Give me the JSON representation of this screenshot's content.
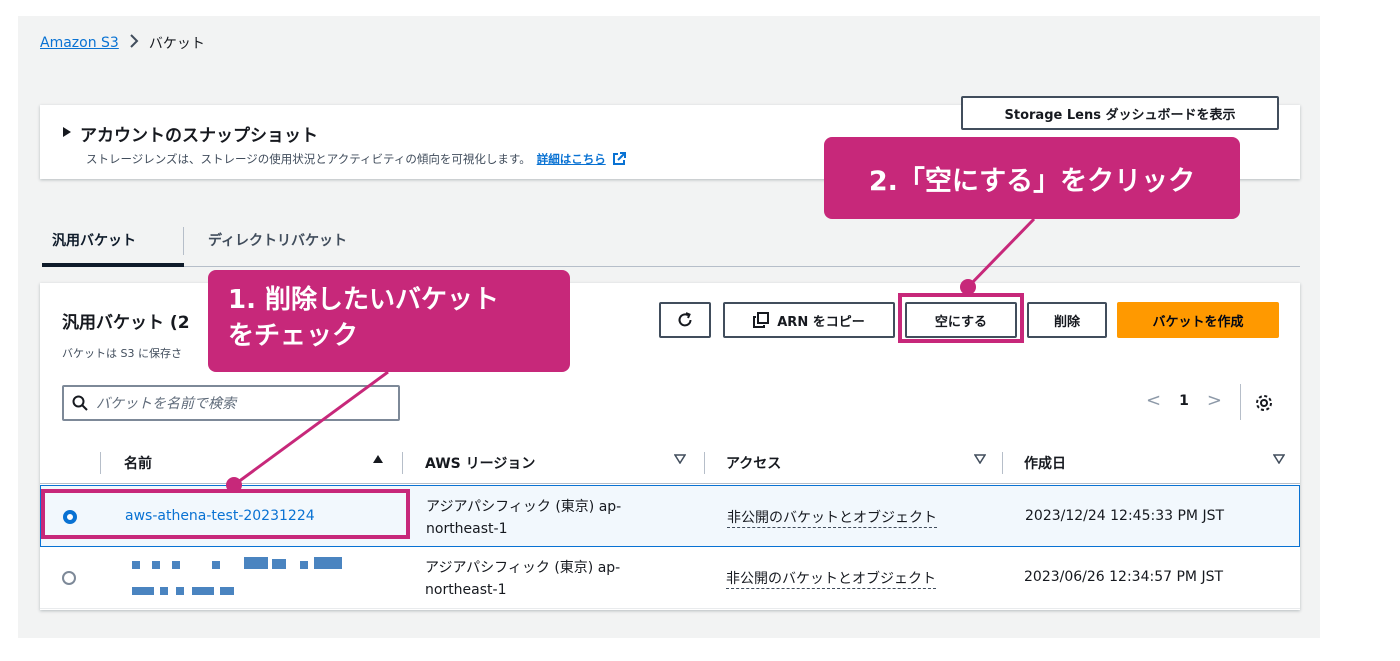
{
  "breadcrumb": {
    "root": "Amazon S3",
    "separator": ">",
    "current": "バケット"
  },
  "snapshot": {
    "title": "アカウントのスナップショット",
    "description": "ストレージレンズは、ストレージの使用状況とアクティビティの傾向を可視化します。",
    "details_link": "詳細はこちら",
    "storage_lens_button": "Storage Lens ダッシュボードを表示"
  },
  "tabs": [
    {
      "label": "汎用バケット",
      "active": true
    },
    {
      "label": "ディレクトリバケット",
      "active": false
    }
  ],
  "buckets": {
    "title": "汎用バケット (2",
    "description": "バケットは S3 に保存さ",
    "actions": {
      "copy_arn": "ARN をコピー",
      "empty": "空にする",
      "delete": "削除",
      "create": "バケットを作成"
    },
    "search_placeholder": "バケットを名前で検索",
    "pagination": {
      "page": "1",
      "prev": "<",
      "next": ">"
    },
    "columns": [
      "名前",
      "AWS リージョン",
      "アクセス",
      "作成日"
    ],
    "rows": [
      {
        "name": "aws-athena-test-20231224",
        "region_line1": "アジアパシフィック (東京) ap-",
        "region_line2": "northeast-1",
        "access": "非公開のバケットとオブジェクト",
        "created": "2023/12/24 12:45:33 PM JST",
        "selected": true
      },
      {
        "name": "",
        "region_line1": "アジアパシフィック (東京) ap-",
        "region_line2": "northeast-1",
        "access": "非公開のバケットとオブジェクト",
        "created": "2023/06/26 12:34:57 PM JST",
        "selected": false
      }
    ]
  },
  "annotations": {
    "callout_1_line1": "1. 削除したいバケット",
    "callout_1_line2": "をチェック",
    "callout_2": "2.「空にする」をクリック",
    "color": "#c7287a"
  },
  "colors": {
    "link": "#0972d3",
    "primary": "#ff9900",
    "annotation": "#c7287a"
  }
}
